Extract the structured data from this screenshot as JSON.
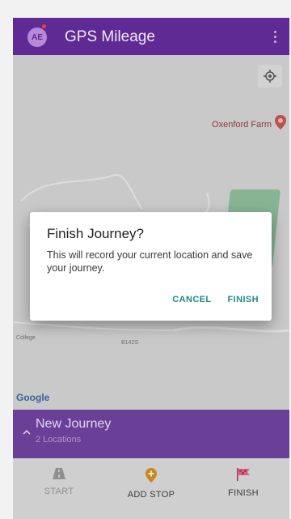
{
  "app": {
    "title": "GPS Mileage",
    "avatar_initials": "AE",
    "brand_color": "#5f2a93"
  },
  "map": {
    "poi_label": "Oxenford Farm",
    "attribution": "Google",
    "label_left": "College",
    "label_mid": "B142S"
  },
  "journey": {
    "title": "New Journey",
    "subtitle": "2 Locations"
  },
  "bottom_nav": {
    "items": [
      {
        "label": "START",
        "icon": "road-icon",
        "color": "#8f8f8f"
      },
      {
        "label": "ADD STOP",
        "icon": "add-location-icon",
        "color": "#c88a1d"
      },
      {
        "label": "FINISH",
        "icon": "finish-flag-icon",
        "color": "#b33a5e"
      }
    ]
  },
  "dialog": {
    "title": "Finish Journey?",
    "body": "This will record your current location and save your journey.",
    "cancel_label": "CANCEL",
    "confirm_label": "FINISH",
    "action_color": "#1f8a85"
  }
}
